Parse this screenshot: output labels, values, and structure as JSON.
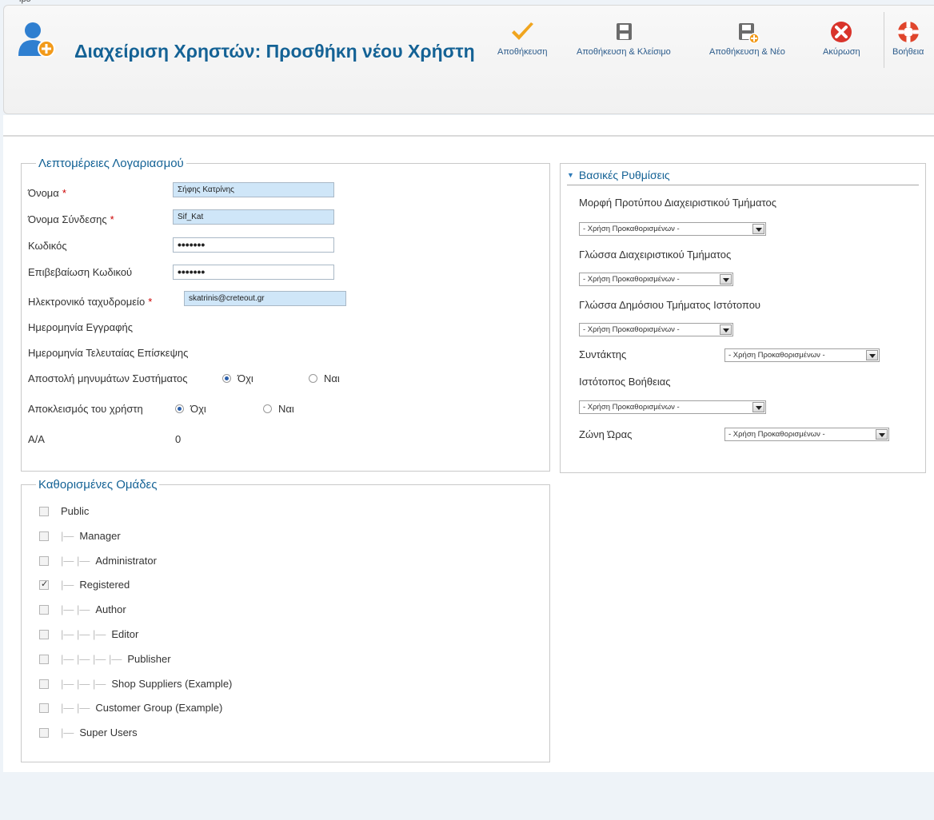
{
  "top_strip_text": "ipo",
  "page_title": "Διαχείριση Χρηστών: Προσθήκη νέου Χρήστη",
  "toolbar": {
    "save": "Αποθήκευση",
    "save_close": "Αποθήκευση & Κλείσιμο",
    "save_new": "Αποθήκευση & Νέο",
    "cancel": "Ακύρωση",
    "help": "Βοήθεια"
  },
  "account": {
    "legend": "Λεπτομέρειες Λογαριασμού",
    "name_label": "Όνομα",
    "name_value": "Σήφης Κατρίνης",
    "username_label": "Όνομα Σύνδεσης",
    "username_value": "Sif_Kat",
    "password_label": "Κωδικός",
    "password_value": "•••••••",
    "confirm_label": "Επιβεβαίωση Κωδικού",
    "confirm_value": "•••••••",
    "email_label": "Ηλεκτρονικό ταχυδρομείο",
    "email_value": "skatrinis@creteout.gr",
    "required_mark": "*",
    "register_date_label": "Ημερομηνία Εγγραφής",
    "last_visit_label": "Ημερομηνία Τελευταίας Επίσκεψης",
    "system_email_label": "Αποστολή μηνυμάτων Συστήματος",
    "block_label": "Αποκλεισμός του χρήστη",
    "no_label": "Όχι",
    "yes_label": "Ναι",
    "id_label": "Α/Α",
    "id_value": "0"
  },
  "groups": {
    "legend": "Καθορισμένες Ομάδες",
    "items": [
      {
        "prefix": "",
        "label": "Public",
        "checked": false
      },
      {
        "prefix": "|—",
        "label": "Manager",
        "checked": false
      },
      {
        "prefix": "|— |—",
        "label": "Administrator",
        "checked": false
      },
      {
        "prefix": "|—",
        "label": "Registered",
        "checked": true
      },
      {
        "prefix": "|— |—",
        "label": "Author",
        "checked": false
      },
      {
        "prefix": "|— |— |—",
        "label": "Editor",
        "checked": false
      },
      {
        "prefix": "|— |— |— |—",
        "label": "Publisher",
        "checked": false
      },
      {
        "prefix": "|— |— |—",
        "label": "Shop Suppliers (Example)",
        "checked": false
      },
      {
        "prefix": "|— |—",
        "label": "Customer Group (Example)",
        "checked": false
      },
      {
        "prefix": "|—",
        "label": "Super Users",
        "checked": false
      }
    ]
  },
  "settings": {
    "title": "Βασικές Ρυθμίσεις",
    "admin_template_label": "Μορφή Προτύπου Διαχειριστικού Τμήματος",
    "admin_language_label": "Γλώσσα Διαχειριστικού Τμήματος",
    "site_language_label": "Γλώσσα Δημόσιου Τμήματος Ιστότοπου",
    "editor_label": "Συντάκτης",
    "help_site_label": "Ιστότοπος Βοήθειας",
    "timezone_label": "Ζώνη Ώρας",
    "default_option": "- Χρήση Προκαθορισμένων -"
  },
  "colors": {
    "title": "#146295",
    "save_icon": "#f0a51f",
    "cancel_icon": "#d9342b"
  }
}
